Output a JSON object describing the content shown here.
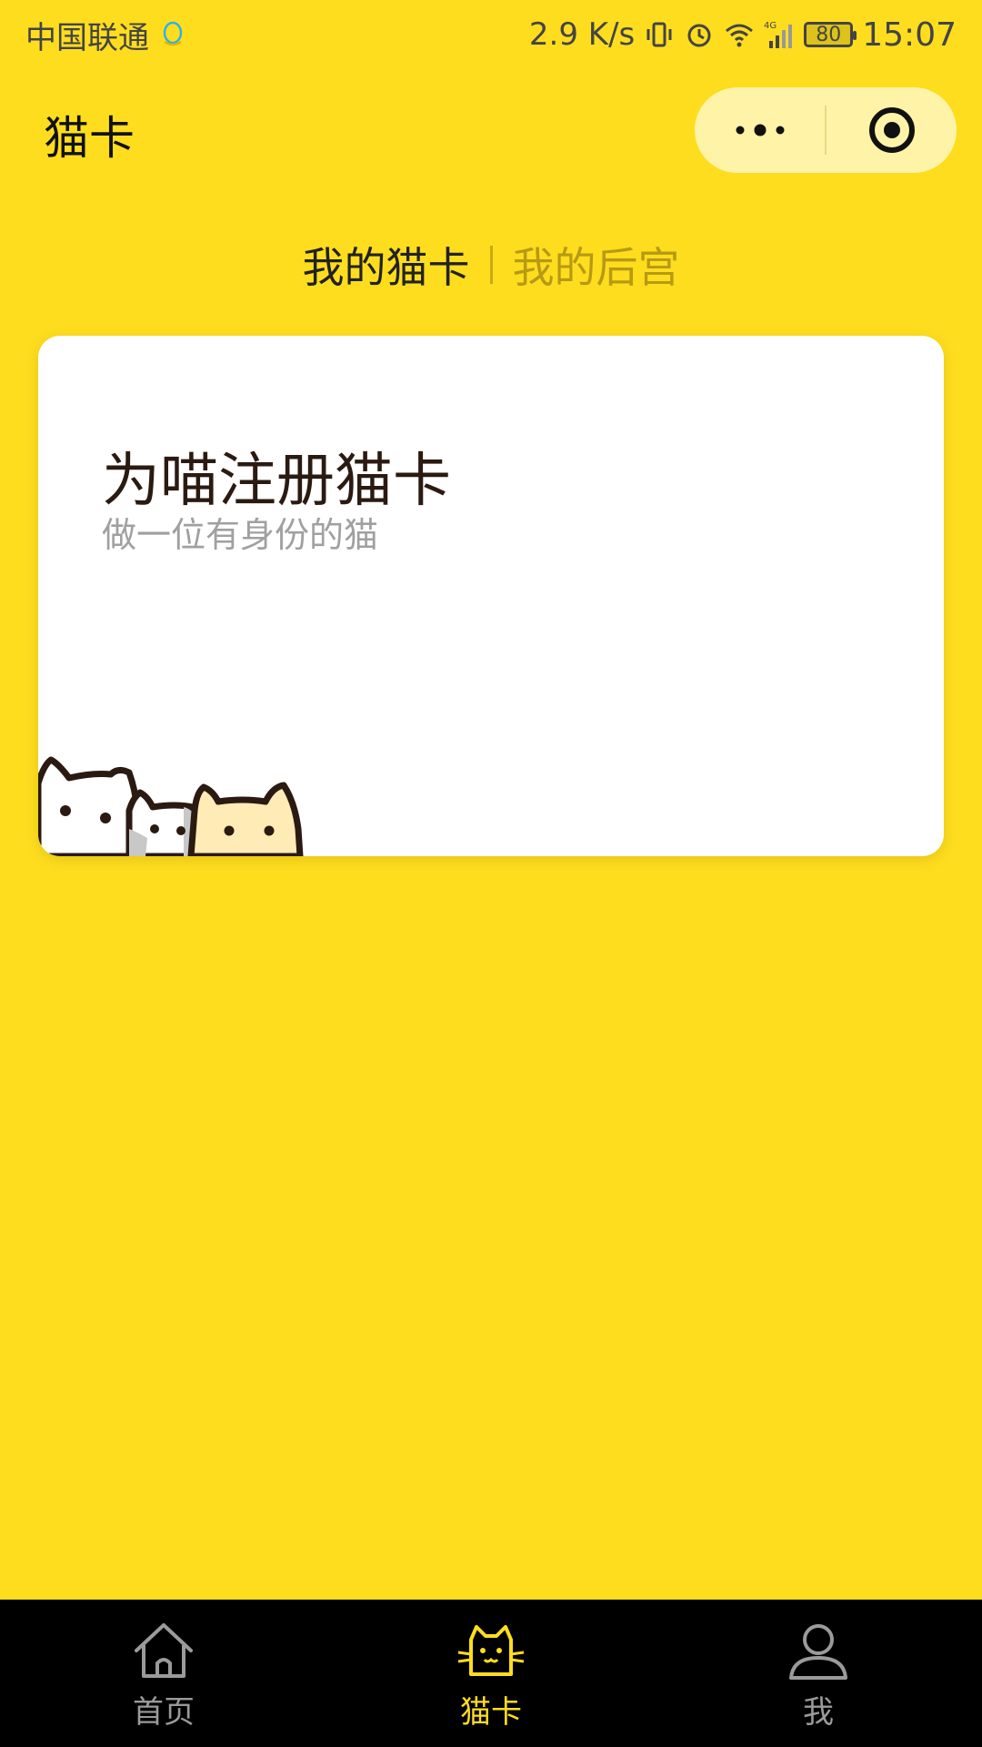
{
  "status_bar": {
    "carrier": "中国联通",
    "net_speed": "2.9 K/s",
    "battery": "80",
    "time": "15:07",
    "icons": [
      "qq-icon",
      "vibrate-icon",
      "alarm-icon",
      "wifi-icon",
      "signal-4g-icon",
      "battery-icon"
    ]
  },
  "nav": {
    "title": "猫卡",
    "capsule": [
      "more-icon",
      "close-target-icon"
    ]
  },
  "tabs": {
    "active": "我的猫卡",
    "inactive": "我的后宫"
  },
  "card": {
    "title": "为喵注册猫卡",
    "subtitle": "做一位有身份的猫"
  },
  "tabbar": {
    "items": [
      {
        "label": "首页",
        "icon": "home-icon",
        "active": false
      },
      {
        "label": "猫卡",
        "icon": "cat-icon",
        "active": true
      },
      {
        "label": "我",
        "icon": "user-icon",
        "active": false
      }
    ]
  },
  "colors": {
    "background": "#FEDD1F",
    "tabbar_bg": "#000000",
    "active": "#FEDD1F",
    "inactive": "#9A9A9A"
  }
}
